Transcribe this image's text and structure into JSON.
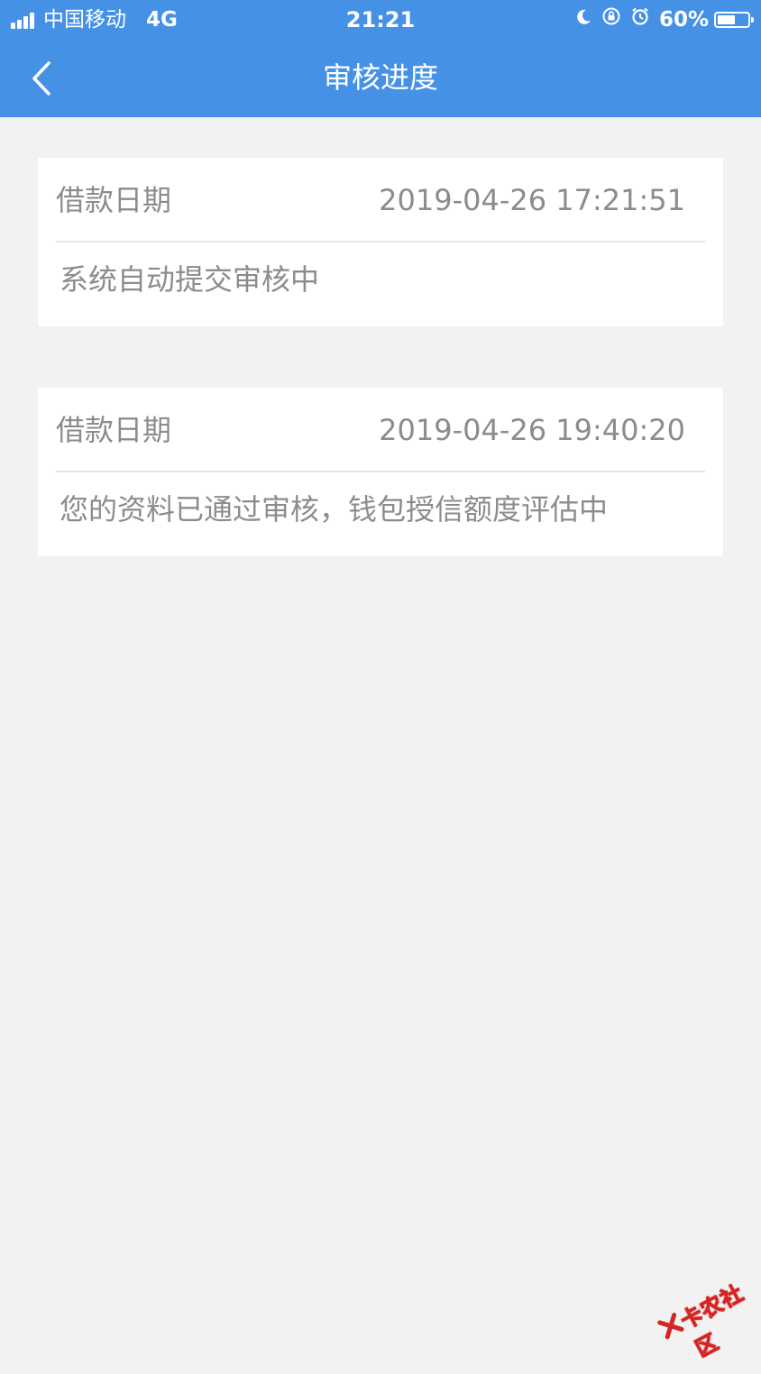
{
  "status_bar": {
    "carrier": "中国移动",
    "network": "4G",
    "time": "21:21",
    "battery_percent": "60%",
    "battery_level": 0.6,
    "icons": [
      "moon-icon",
      "orientation-lock-icon",
      "alarm-icon"
    ]
  },
  "nav": {
    "title": "审核进度",
    "back_icon": "chevron-left-icon"
  },
  "records": [
    {
      "label": "借款日期",
      "datetime": "2019-04-26 17:21:51",
      "status": "系统自动提交审核中"
    },
    {
      "label": "借款日期",
      "datetime": "2019-04-26 19:40:20",
      "status": "您的资料已通过审核，钱包授信额度评估中"
    }
  ],
  "watermark": {
    "text": "卡农社区",
    "color": "#d62424"
  },
  "colors": {
    "header": "#4591e6",
    "background": "#f2f2f2",
    "card": "#ffffff",
    "text_secondary": "#8c8c8c"
  }
}
